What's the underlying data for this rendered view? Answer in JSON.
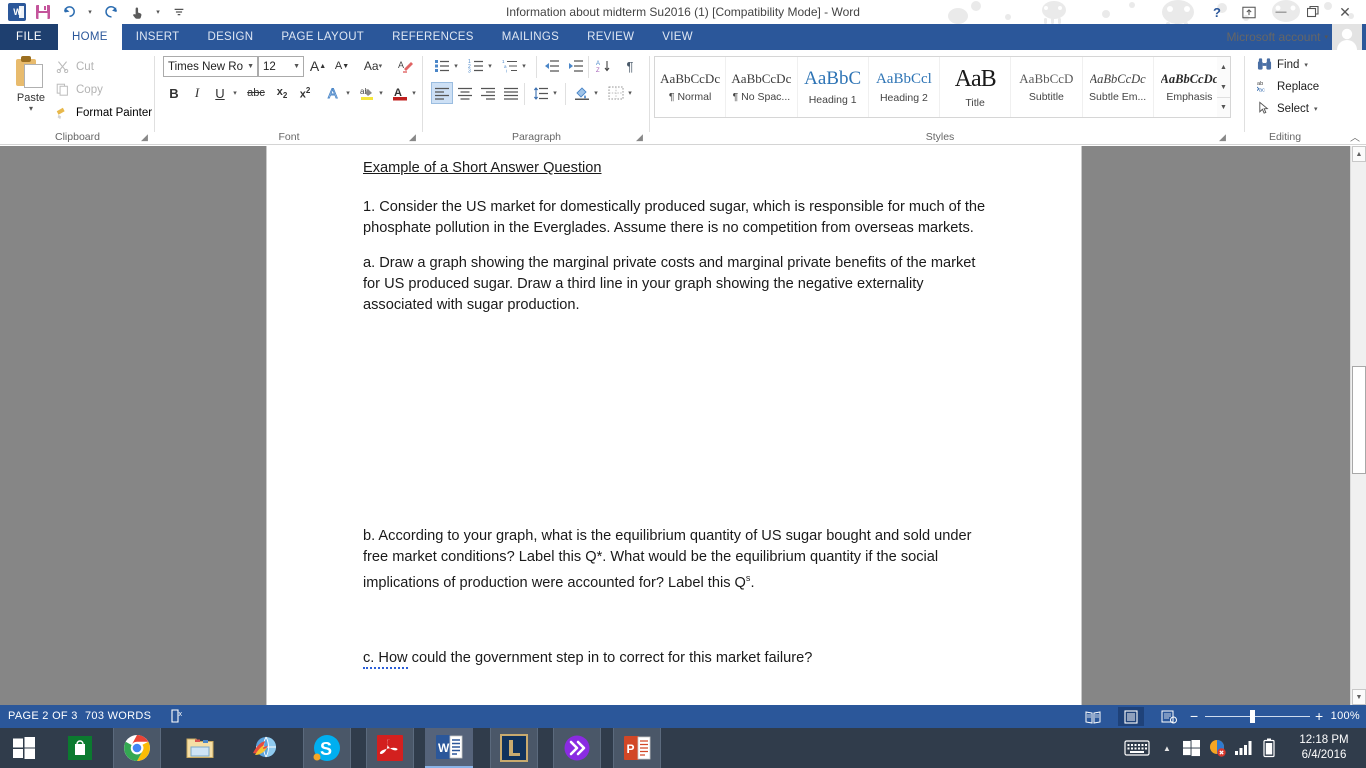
{
  "window": {
    "title": "Information about midterm Su2016 (1) [Compatibility Mode] - Word",
    "account_label": "Microsoft account",
    "help_icon": "?",
    "ribbon_display_icon": "ribbon-display-options-icon",
    "minimize_icon": "—",
    "restore_icon": "❐",
    "close_icon": "✕"
  },
  "quick_access": {
    "app_logo": "word-logo",
    "items": [
      {
        "name": "save",
        "icon": "save-icon"
      },
      {
        "name": "undo",
        "icon": "undo-icon"
      },
      {
        "name": "redo",
        "icon": "redo-icon"
      },
      {
        "name": "touch-mode",
        "icon": "touch-mode-icon"
      },
      {
        "name": "customize",
        "icon": "customize-qat-icon"
      }
    ]
  },
  "tabs": {
    "file": "FILE",
    "items": [
      {
        "label": "HOME",
        "active": true
      },
      {
        "label": "INSERT",
        "active": false
      },
      {
        "label": "DESIGN",
        "active": false
      },
      {
        "label": "PAGE LAYOUT",
        "active": false
      },
      {
        "label": "REFERENCES",
        "active": false
      },
      {
        "label": "MAILINGS",
        "active": false
      },
      {
        "label": "REVIEW",
        "active": false
      },
      {
        "label": "VIEW",
        "active": false
      }
    ]
  },
  "ribbon": {
    "clipboard": {
      "label": "Clipboard",
      "paste": "Paste",
      "cut": "Cut",
      "copy": "Copy",
      "format_painter": "Format Painter"
    },
    "font": {
      "label": "Font",
      "font_name": "Times New Ro",
      "font_size": "12",
      "grow_font": "A",
      "shrink_font": "A",
      "change_case": "Aa",
      "clear_formatting": "clear-formatting-icon",
      "bold": "B",
      "italic": "I",
      "underline": "U",
      "strikethrough": "abc",
      "subscript": "x₂",
      "superscript": "x²",
      "text_effects": "A",
      "highlight": "ab",
      "font_color": "A"
    },
    "paragraph": {
      "label": "Paragraph",
      "bullets": "bullets-icon",
      "numbering": "numbering-icon",
      "multilevel": "multilevel-list-icon",
      "decrease_indent": "decrease-indent-icon",
      "increase_indent": "increase-indent-icon",
      "sort": "sort-icon",
      "show_marks": "¶",
      "align_left": "align-left-icon",
      "align_center": "align-center-icon",
      "align_right": "align-right-icon",
      "justify": "justify-icon",
      "line_spacing": "line-spacing-icon",
      "shading": "shading-icon",
      "borders": "borders-icon"
    },
    "styles": {
      "label": "Styles",
      "items": [
        {
          "preview": "AaBbCcDc",
          "name": "¶ Normal",
          "kind": "normal"
        },
        {
          "preview": "AaBbCcDc",
          "name": "¶ No Spac...",
          "kind": "normal"
        },
        {
          "preview": "AaBbC",
          "name": "Heading 1",
          "kind": "h1"
        },
        {
          "preview": "AaBbCcl",
          "name": "Heading 2",
          "kind": "h2"
        },
        {
          "preview": "AaB",
          "name": "Title",
          "kind": "title"
        },
        {
          "preview": "AaBbCcD",
          "name": "Subtitle",
          "kind": "sub"
        },
        {
          "preview": "AaBbCcDc",
          "name": "Subtle Em...",
          "kind": "em"
        },
        {
          "preview": "AaBbCcDc",
          "name": "Emphasis",
          "kind": "emph"
        }
      ]
    },
    "editing": {
      "label": "Editing",
      "find": "Find",
      "replace": "Replace",
      "select": "Select"
    }
  },
  "document": {
    "paragraphs": [
      {
        "id": "heading",
        "text": "Example of a Short Answer Question",
        "underline": true
      },
      {
        "id": "q1",
        "text": "1. Consider the US market for domestically produced sugar, which is responsible for much of the phosphate pollution in the Everglades.  Assume there is no competition from overseas markets."
      },
      {
        "id": "qa",
        "text": "a. Draw a graph showing the marginal private costs and marginal private benefits of the market for US produced sugar.  Draw a third line in your graph showing the negative externality associated with sugar production."
      },
      {
        "id": "qb_part1",
        "text": "b. According to your graph, what is the equilibrium quantity of US sugar bought and sold under free market conditions?  Label this Q*.  What would be the equilibrium quantity if the social implications of production were accounted for? Label this Q"
      },
      {
        "id": "qb_sup",
        "text": "s"
      },
      {
        "id": "qb_part2",
        "text": "."
      },
      {
        "id": "qc_marked",
        "text": "c.  How"
      },
      {
        "id": "qc_rest",
        "text": " could the government step in to correct for this market failure?"
      }
    ]
  },
  "status_bar": {
    "page": "PAGE 2 OF 3",
    "words": "703 WORDS",
    "proofing_icon": "proofing-errors-icon",
    "views": [
      {
        "name": "read-mode",
        "icon": "read-mode-icon",
        "active": false
      },
      {
        "name": "print-layout",
        "icon": "print-layout-icon",
        "active": true
      },
      {
        "name": "web-layout",
        "icon": "web-layout-icon",
        "active": false
      }
    ],
    "zoom_out": "−",
    "zoom_in": "+",
    "zoom_level": "100%"
  },
  "taskbar": {
    "items": [
      {
        "name": "start-button",
        "icon": "windows-logo-icon",
        "state": "none"
      },
      {
        "name": "microsoft-store",
        "icon": "store-bag-icon",
        "state": "none"
      },
      {
        "name": "google-chrome",
        "icon": "chrome-icon",
        "state": "open"
      },
      {
        "name": "file-explorer",
        "icon": "folder-icon",
        "state": "none"
      },
      {
        "name": "internet-app",
        "icon": "globe-icon",
        "state": "none"
      },
      {
        "name": "skype",
        "icon": "skype-icon",
        "state": "open"
      },
      {
        "name": "adobe-reader",
        "icon": "adobe-acrobat-icon",
        "state": "open"
      },
      {
        "name": "microsoft-word",
        "icon": "word-icon",
        "state": "focus"
      },
      {
        "name": "league-of-legends",
        "icon": "league-of-legends-icon",
        "state": "open"
      },
      {
        "name": "purple-app",
        "icon": "double-chevron-icon",
        "state": "open"
      },
      {
        "name": "microsoft-powerpoint",
        "icon": "powerpoint-icon",
        "state": "open"
      }
    ],
    "tray": {
      "keyboard_icon": "touch-keyboard-icon",
      "show_hidden_icon": "▲",
      "windows_icon": "windows-flag-icon",
      "alert_icon": "action-center-alert-icon",
      "network_icon": "signal-bars-icon",
      "battery_icon": "battery-icon",
      "time": "12:18 PM",
      "date": "6/4/2016"
    }
  }
}
